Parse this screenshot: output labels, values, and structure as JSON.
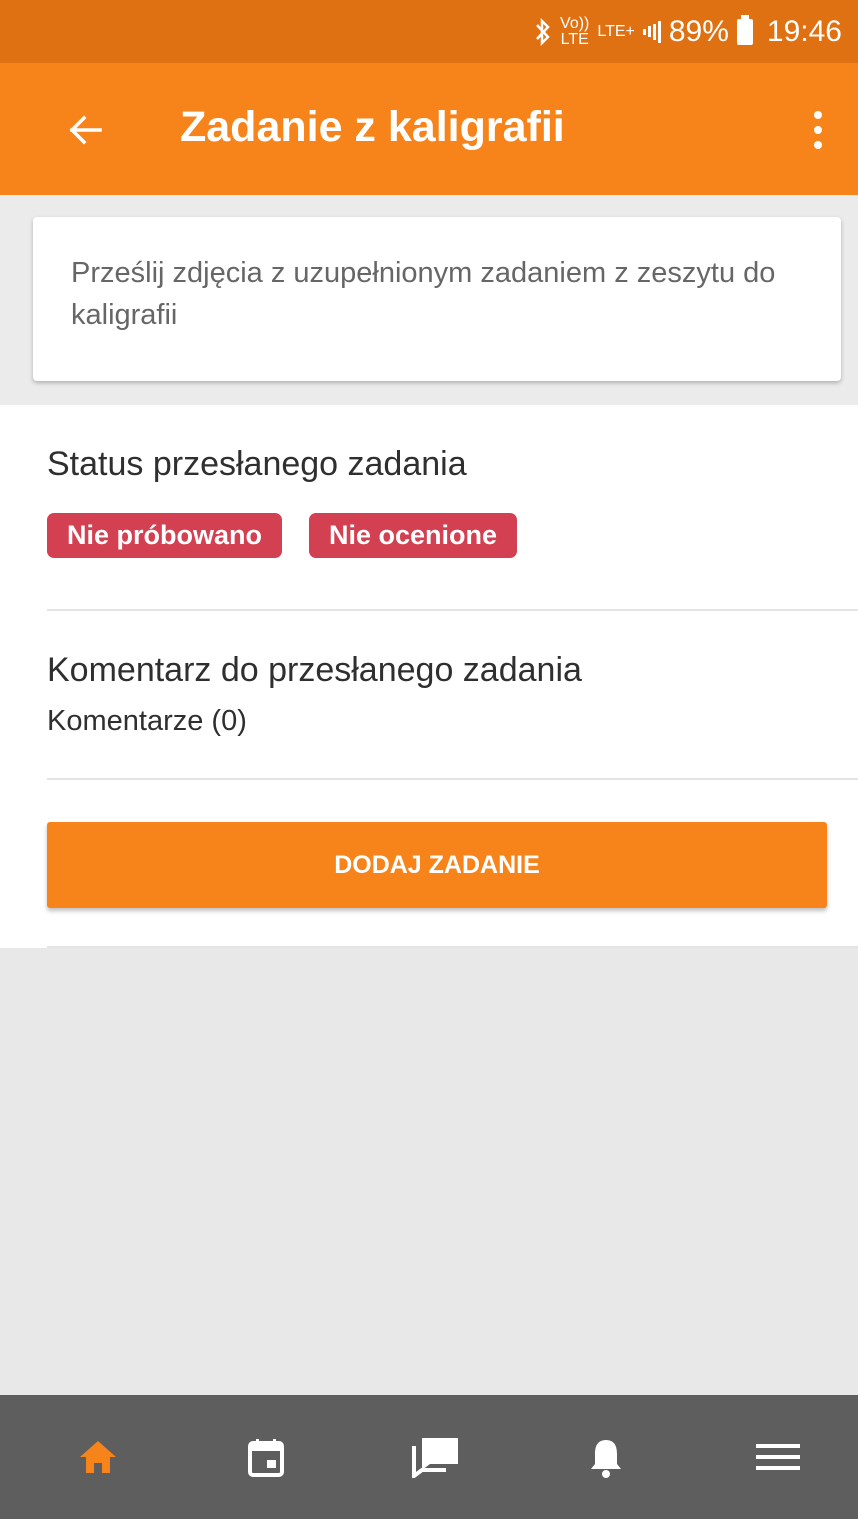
{
  "status_bar": {
    "network_top": "Vo))",
    "network_bottom": "LTE",
    "lte_label": "LTE+",
    "battery": "89%",
    "time": "19:46"
  },
  "app_bar": {
    "title": "Zadanie z kaligrafii",
    "back_icon": "arrow-left-icon",
    "menu_icon": "more-vert-icon"
  },
  "task": {
    "description": "Prześlij zdjęcia z uzupełnionym zadaniem z zeszytu do kaligrafii"
  },
  "status_section": {
    "heading": "Status przesłanego zadania",
    "badges": [
      "Nie próbowano",
      "Nie ocenione"
    ],
    "badge_color": "#d24052"
  },
  "comment_section": {
    "heading": "Komentarz do przesłanego zadania",
    "count_label": "Komentarze (0)"
  },
  "actions": {
    "add_task_label": "DODAJ ZADANIE"
  },
  "bottom_nav": {
    "items": [
      "home-icon",
      "calendar-icon",
      "messages-icon",
      "bell-icon",
      "menu-icon"
    ],
    "active_color": "#f7841a",
    "inactive_color": "#ffffff"
  },
  "colors": {
    "accent": "#f7841a",
    "status_bar": "#e07112"
  }
}
